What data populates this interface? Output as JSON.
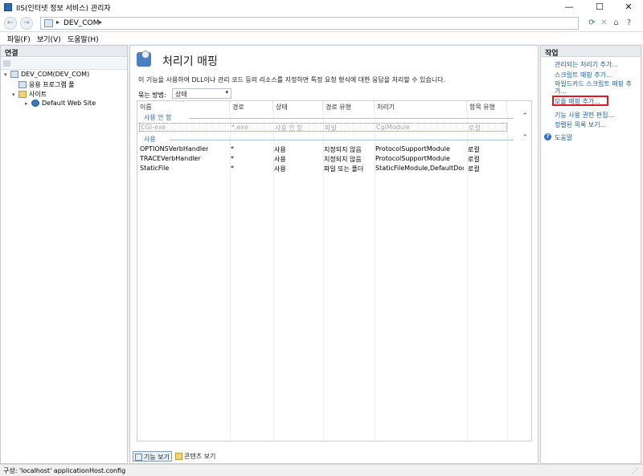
{
  "window": {
    "title": "IIS(인터넷 정보 서비스) 관리자",
    "controls": {
      "minimize": "—",
      "maximize": "☐",
      "close": "✕"
    }
  },
  "address_bar": {
    "back": "←",
    "forward": "→",
    "separator": "▸",
    "crumb": "DEV_COM",
    "trailing_separator": "▸",
    "icons": [
      "globe-refresh-icon",
      "stop-icon",
      "home-icon",
      "help-icon"
    ]
  },
  "menu": {
    "items": [
      "파일(F)",
      "보기(V)",
      "도움말(H)"
    ]
  },
  "connections": {
    "header": "연결",
    "tree": [
      {
        "label": "DEV_COM(DEV_COM)",
        "expander": "▾"
      },
      {
        "label": "응용 프로그램 풀"
      },
      {
        "label": "사이트",
        "expander": "▾"
      },
      {
        "label": "Default Web Site",
        "expander": "▸"
      }
    ]
  },
  "feature": {
    "title": "처리기 매핑",
    "description": "이 기능을 사용하여 DLL이나 관리 코드 등의 리소스를 지정하면 특정 요청 형식에 대한 응답을 처리할 수 있습니다.",
    "group_by_label": "묶는 방법:",
    "group_by_value": "상태",
    "sort_indicator": "^",
    "columns": [
      "이름",
      "경로",
      "상태",
      "경로 유형",
      "처리기",
      "항목 유형"
    ],
    "groups": [
      {
        "label": "사용 안 함",
        "collapse_glyph": "⌃",
        "rows": [
          [
            "CGI-exe",
            "*.exe",
            "사용 안 함",
            "파일",
            "CgiModule",
            "로컬"
          ]
        ]
      },
      {
        "label": "사용",
        "collapse_glyph": "⌃",
        "rows": [
          [
            "OPTIONSVerbHandler",
            "*",
            "사용",
            "지정되지 않음",
            "ProtocolSupportModule",
            "로컬"
          ],
          [
            "TRACEVerbHandler",
            "*",
            "사용",
            "지정되지 않음",
            "ProtocolSupportModule",
            "로컬"
          ],
          [
            "StaticFile",
            "*",
            "사용",
            "파일 또는 폴더",
            "StaticFileModule,DefaultDoc...",
            "로컬"
          ]
        ]
      }
    ],
    "tabs": [
      "기능 보기",
      "콘텐츠 보기"
    ]
  },
  "actions": {
    "header": "작업",
    "items": [
      "관리되는 처리기 추가...",
      "스크립트 매핑 추가...",
      "와일드카드 스크립트 매핑 추가...",
      "모듈 매핑 추가...",
      "기능 사용 권한 편집...",
      "정렬된 목록 보기..."
    ],
    "help": "도움말",
    "highlight_color": "#e2181f"
  },
  "status": {
    "text": "구성: 'localhost' applicationHost.config"
  }
}
